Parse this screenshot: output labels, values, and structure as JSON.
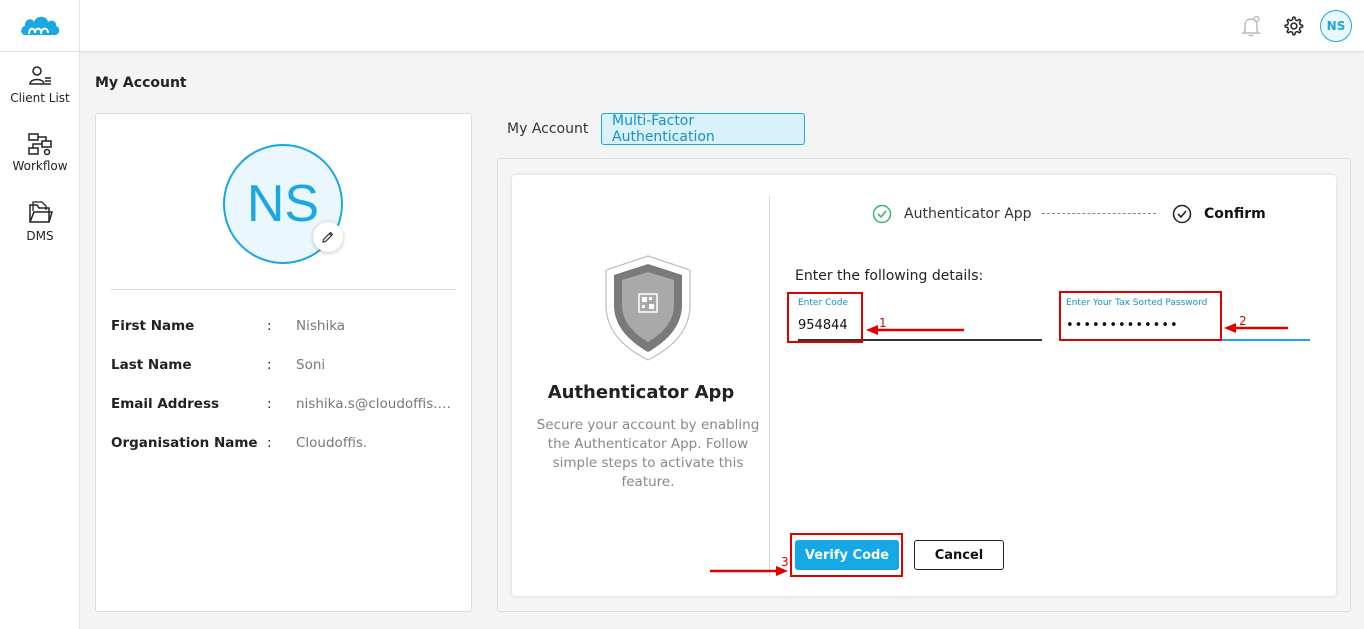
{
  "header": {
    "logo_icon": "cloud-logo-icon",
    "notification_icon": "bell-icon",
    "settings_icon": "gear-icon",
    "avatar_initials": "NS",
    "accent_color": "#1aa7e2"
  },
  "sidebar": {
    "items": [
      {
        "label": "Client List",
        "icon": "user-list-icon"
      },
      {
        "label": "Workflow",
        "icon": "workflow-icon"
      },
      {
        "label": "DMS",
        "icon": "folder-icon"
      }
    ]
  },
  "page": {
    "title": "My Account"
  },
  "profile": {
    "initials": "NS",
    "edit_icon": "pencil-icon",
    "fields": [
      {
        "label": "First Name",
        "sep": ":",
        "value": "Nishika"
      },
      {
        "label": "Last Name",
        "sep": ":",
        "value": "Soni"
      },
      {
        "label": "Email Address",
        "sep": ":",
        "value": "nishika.s@cloudoffis.c..."
      },
      {
        "label": "Organisation Name",
        "sep": ":",
        "value": "Cloudoffis."
      }
    ]
  },
  "tabs": [
    {
      "label": "My Account",
      "active": false
    },
    {
      "label": "Multi-Factor Authentication",
      "active": true
    }
  ],
  "mfa": {
    "method_title": "Authenticator App",
    "method_desc": "Secure your account by enabling the Authenticator App. Follow simple steps to activate this feature.",
    "steps": [
      {
        "label": "Authenticator App",
        "state": "done"
      },
      {
        "label": "Confirm",
        "state": "current"
      }
    ],
    "details_label": "Enter the following details:",
    "code_field": {
      "label": "Enter Code",
      "value": "954844"
    },
    "password_field": {
      "label": "Enter Your Tax Sorted Password",
      "value": "•••••••••••••"
    },
    "verify_label": "Verify Code",
    "cancel_label": "Cancel"
  },
  "annotations": {
    "num1": "1",
    "num2": "2",
    "num3": "3",
    "color": "#e00000"
  }
}
